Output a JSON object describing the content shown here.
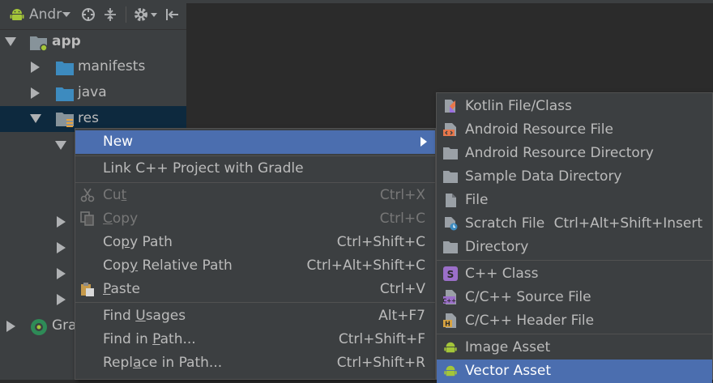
{
  "toolbar": {
    "view_label": "Andr",
    "icons": [
      "android-icon",
      "chevron-down-icon",
      "target-icon",
      "collapse-icon",
      "gear-icon",
      "chevron-down-icon",
      "hide-icon"
    ]
  },
  "tree": {
    "items": [
      {
        "label": "app",
        "icon": "module-folder-icon"
      },
      {
        "label": "manifests",
        "icon": "folder-icon"
      },
      {
        "label": "java",
        "icon": "folder-icon"
      },
      {
        "label": "res",
        "icon": "resource-folder-icon"
      },
      {
        "label": "Gra",
        "icon": "gradle-icon"
      }
    ]
  },
  "context_menu": {
    "items": [
      {
        "label": "New",
        "shortcut": ""
      },
      {
        "label": "Link C++ Project with Gradle",
        "shortcut": ""
      },
      {
        "label_pre": "Cu",
        "label_mn": "t",
        "label_post": "",
        "shortcut": "Ctrl+X"
      },
      {
        "label_pre": "",
        "label_mn": "C",
        "label_post": "opy",
        "shortcut": "Ctrl+C"
      },
      {
        "label_pre": "Co",
        "label_mn": "p",
        "label_post": "y Path",
        "shortcut": "Ctrl+Shift+C"
      },
      {
        "label_pre": "Cop",
        "label_mn": "y",
        "label_post": " Relative Path",
        "shortcut": "Ctrl+Alt+Shift+C"
      },
      {
        "label_pre": "",
        "label_mn": "P",
        "label_post": "aste",
        "shortcut": "Ctrl+V"
      },
      {
        "label_pre": "Find ",
        "label_mn": "U",
        "label_post": "sages",
        "shortcut": "Alt+F7"
      },
      {
        "label_pre": "Find in ",
        "label_mn": "P",
        "label_post": "ath...",
        "shortcut": "Ctrl+Shift+F"
      },
      {
        "label_pre": "Repl",
        "label_mn": "a",
        "label_post": "ce in Path...",
        "shortcut": "Ctrl+Shift+R"
      }
    ]
  },
  "submenu": {
    "items": [
      {
        "label": "Kotlin File/Class",
        "icon": "kotlin-icon",
        "shortcut": ""
      },
      {
        "label": "Android Resource File",
        "icon": "xml-file-icon",
        "shortcut": ""
      },
      {
        "label": "Android Resource Directory",
        "icon": "folder-icon",
        "shortcut": ""
      },
      {
        "label": "Sample Data Directory",
        "icon": "folder-icon",
        "shortcut": ""
      },
      {
        "label": "File",
        "icon": "file-icon",
        "shortcut": ""
      },
      {
        "label": "Scratch File",
        "icon": "scratch-file-icon",
        "shortcut": "Ctrl+Alt+Shift+Insert"
      },
      {
        "label": "Directory",
        "icon": "folder-icon",
        "shortcut": ""
      },
      {
        "label": "C++ Class",
        "icon": "cpp-class-icon",
        "shortcut": ""
      },
      {
        "label": "C/C++ Source File",
        "icon": "cpp-source-icon",
        "shortcut": ""
      },
      {
        "label": "C/C++ Header File",
        "icon": "cpp-header-icon",
        "shortcut": ""
      },
      {
        "label": "Image Asset",
        "icon": "android-icon",
        "shortcut": ""
      },
      {
        "label": "Vector Asset",
        "icon": "android-icon",
        "shortcut": ""
      }
    ]
  },
  "colors": {
    "highlight": "#4b6eaf",
    "folder": "#3d8bbf",
    "android": "#a4c639",
    "selection": "#0d293e"
  }
}
